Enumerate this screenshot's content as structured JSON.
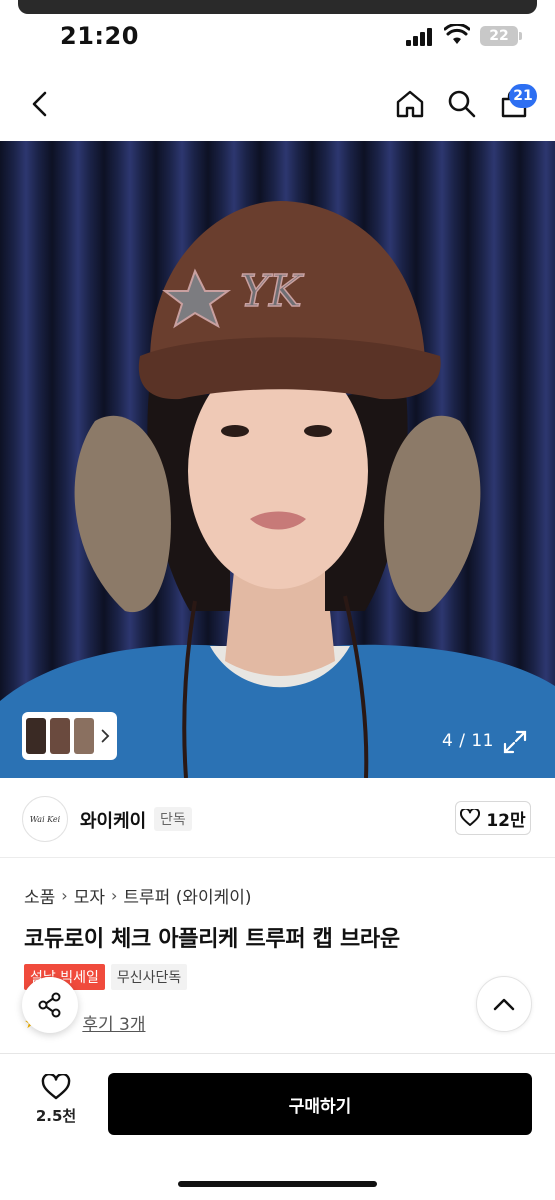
{
  "status_bar": {
    "time": "21:20",
    "battery": "22",
    "icons": [
      "signal-icon",
      "wifi-icon",
      "battery-icon"
    ]
  },
  "nav": {
    "icons": [
      "back-icon",
      "home-icon",
      "search-icon",
      "cart-icon"
    ],
    "cart_badge": "21",
    "badge_color": "#2d6ff2"
  },
  "hero": {
    "page_counter": "4 / 11",
    "icons": [
      "chevron-right-icon",
      "expand-icon"
    ]
  },
  "brand": {
    "logo_text": "Wai Kei",
    "name": "와이케이",
    "exclusive_tag": "단독",
    "likes": "12만",
    "like_icon": "heart-outline-icon"
  },
  "breadcrumb": {
    "items": [
      "소품",
      "모자",
      "트루퍼 (와이케이)"
    ]
  },
  "product": {
    "title": "코듀로이 체크 아플리케 트루퍼 캡 브라운",
    "tags": [
      "설날 빅세일",
      "무신사단독"
    ],
    "sale_color": "#f04b3c",
    "review_text": "후기 3개"
  },
  "bottom_bar": {
    "wish_count": "2.5천",
    "buy_label": "구매하기",
    "icons": [
      "heart-outline-icon",
      "share-icon",
      "chevron-up-icon"
    ]
  }
}
